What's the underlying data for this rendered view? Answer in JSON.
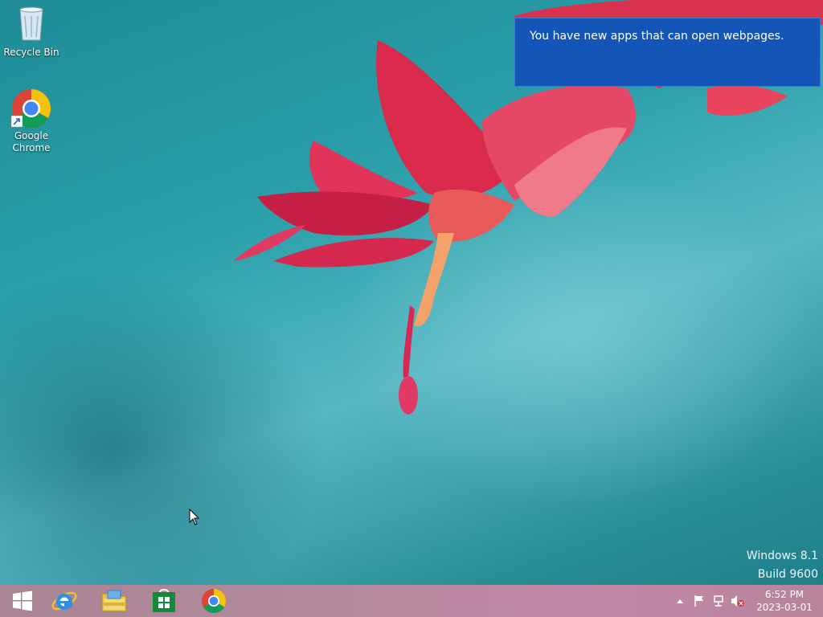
{
  "desktop": {
    "icons": [
      {
        "label": "Recycle Bin"
      },
      {
        "label": "Google Chrome"
      }
    ]
  },
  "toast": {
    "message": "You have new apps that can open webpages."
  },
  "watermark": {
    "line1": "Windows 8.1",
    "line2": "Build 9600"
  },
  "taskbar": {
    "pinned": [
      {
        "icon": "internet-explorer-icon"
      },
      {
        "icon": "file-explorer-icon"
      },
      {
        "icon": "store-icon"
      },
      {
        "icon": "chrome-icon"
      }
    ],
    "tray": {
      "icons": [
        "show-hidden-icons-arrow",
        "action-center-flag-icon",
        "network-icon",
        "volume-muted-icon"
      ],
      "time": "6:52 PM",
      "date": "2023-03-01"
    }
  },
  "colors": {
    "toast_bg": "#1456b8",
    "desktop_bg": "#2aa0aa",
    "taskbar_bg": "#b48a9e"
  }
}
